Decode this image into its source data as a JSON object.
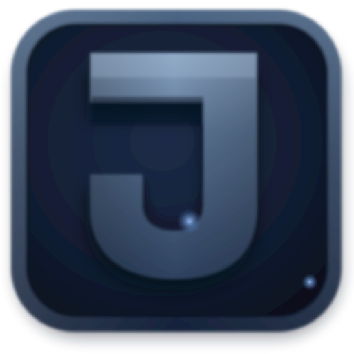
{
  "icon": {
    "name": "app-icon",
    "glyph": "J",
    "semantic_icon": "letter-j-app-icon",
    "colors": {
      "page_background": "#ffffff",
      "frame_light": "#4d6685",
      "frame_mid": "#2c405c",
      "frame_dark": "#15223a",
      "face_dark": "#0c1424",
      "face_mid": "#1a2a45",
      "glyph_top": "#7f99b8",
      "glyph_mid": "#4d6684",
      "glyph_dark": "#2a3d59",
      "glint": "#6ea0e0"
    }
  }
}
